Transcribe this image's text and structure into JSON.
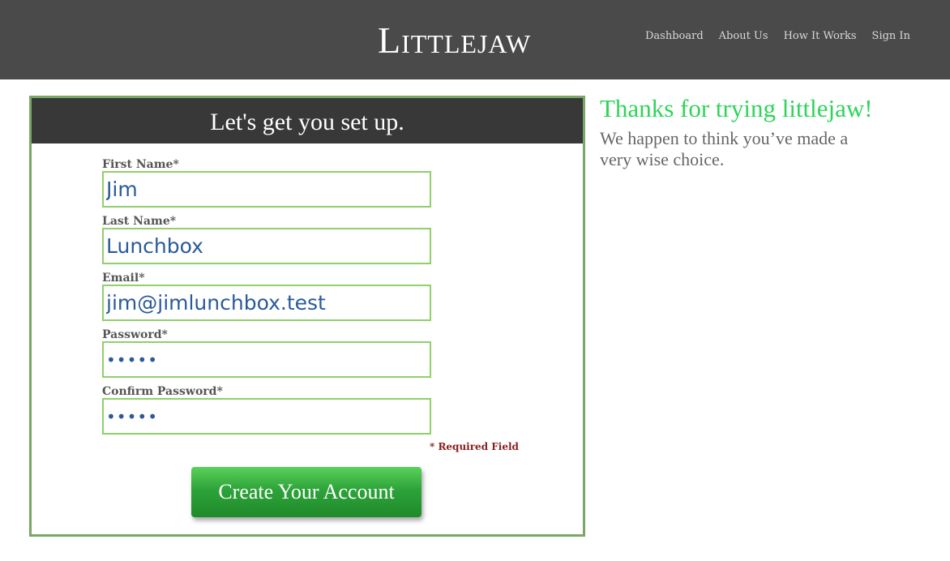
{
  "header": {
    "logo": "Littlejaw",
    "nav": [
      "Dashboard",
      "About Us",
      "How It Works",
      "Sign In"
    ]
  },
  "form": {
    "heading": "Let's get you set up.",
    "fields": [
      {
        "label": "First Name*",
        "value": "Jim"
      },
      {
        "label": "Last Name*",
        "value": "Lunchbox"
      },
      {
        "label": "Email*",
        "value": "jim@jimlunchbox.test"
      },
      {
        "label": "Password*",
        "value": "•••••"
      },
      {
        "label": "Confirm Password*",
        "value": "•••••"
      }
    ],
    "required_note": "* Required Field",
    "submit_label": "Create Your Account"
  },
  "sidebar": {
    "title": "Thanks for trying littlejaw!",
    "subtitle": "We happen to think you’ve made a very wise choice."
  },
  "colors": {
    "header_bg": "#4a4a4a",
    "panel_border": "#7aa666",
    "input_border": "#8fd06a",
    "accent_green": "#2ed45a",
    "input_text": "#2b5a9a",
    "required_red": "#8a1c1c"
  }
}
